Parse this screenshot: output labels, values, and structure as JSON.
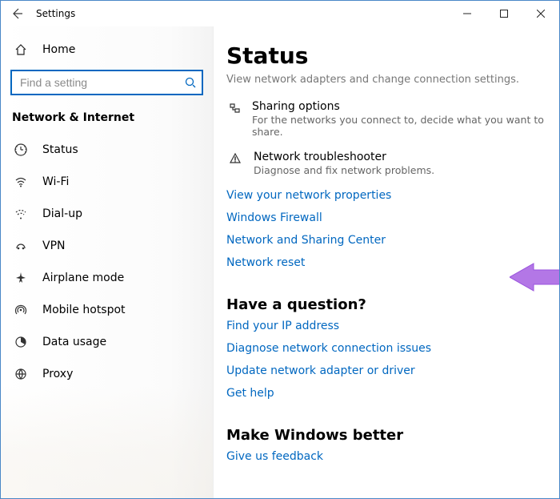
{
  "window": {
    "title": "Settings"
  },
  "sidebar": {
    "home_label": "Home",
    "search_placeholder": "Find a setting",
    "section_title": "Network & Internet",
    "items": [
      {
        "label": "Status",
        "icon": "status-icon",
        "selected": false
      },
      {
        "label": "Wi-Fi",
        "icon": "wifi-icon",
        "selected": false
      },
      {
        "label": "Dial-up",
        "icon": "dialup-icon",
        "selected": false
      },
      {
        "label": "VPN",
        "icon": "vpn-icon",
        "selected": false
      },
      {
        "label": "Airplane mode",
        "icon": "airplane-icon",
        "selected": false
      },
      {
        "label": "Mobile hotspot",
        "icon": "hotspot-icon",
        "selected": false
      },
      {
        "label": "Data usage",
        "icon": "datausage-icon",
        "selected": false
      },
      {
        "label": "Proxy",
        "icon": "proxy-icon",
        "selected": false
      }
    ]
  },
  "content": {
    "page_title": "Status",
    "truncated_line": "View network adapters and change connection settings.",
    "rows": [
      {
        "title": "Sharing options",
        "sub": "For the networks you connect to, decide what you want to share.",
        "icon": "sharing-icon"
      },
      {
        "title": "Network troubleshooter",
        "sub": "Diagnose and fix network problems.",
        "icon": "troubleshoot-icon"
      }
    ],
    "links_primary": [
      "View your network properties",
      "Windows Firewall",
      "Network and Sharing Center",
      "Network reset"
    ],
    "question_heading": "Have a question?",
    "links_question": [
      "Find your IP address",
      "Diagnose network connection issues",
      "Update network adapter or driver",
      "Get help"
    ],
    "better_heading": "Make Windows better",
    "links_better": [
      "Give us feedback"
    ]
  },
  "annotation": {
    "arrow_color": "#b377e6"
  }
}
